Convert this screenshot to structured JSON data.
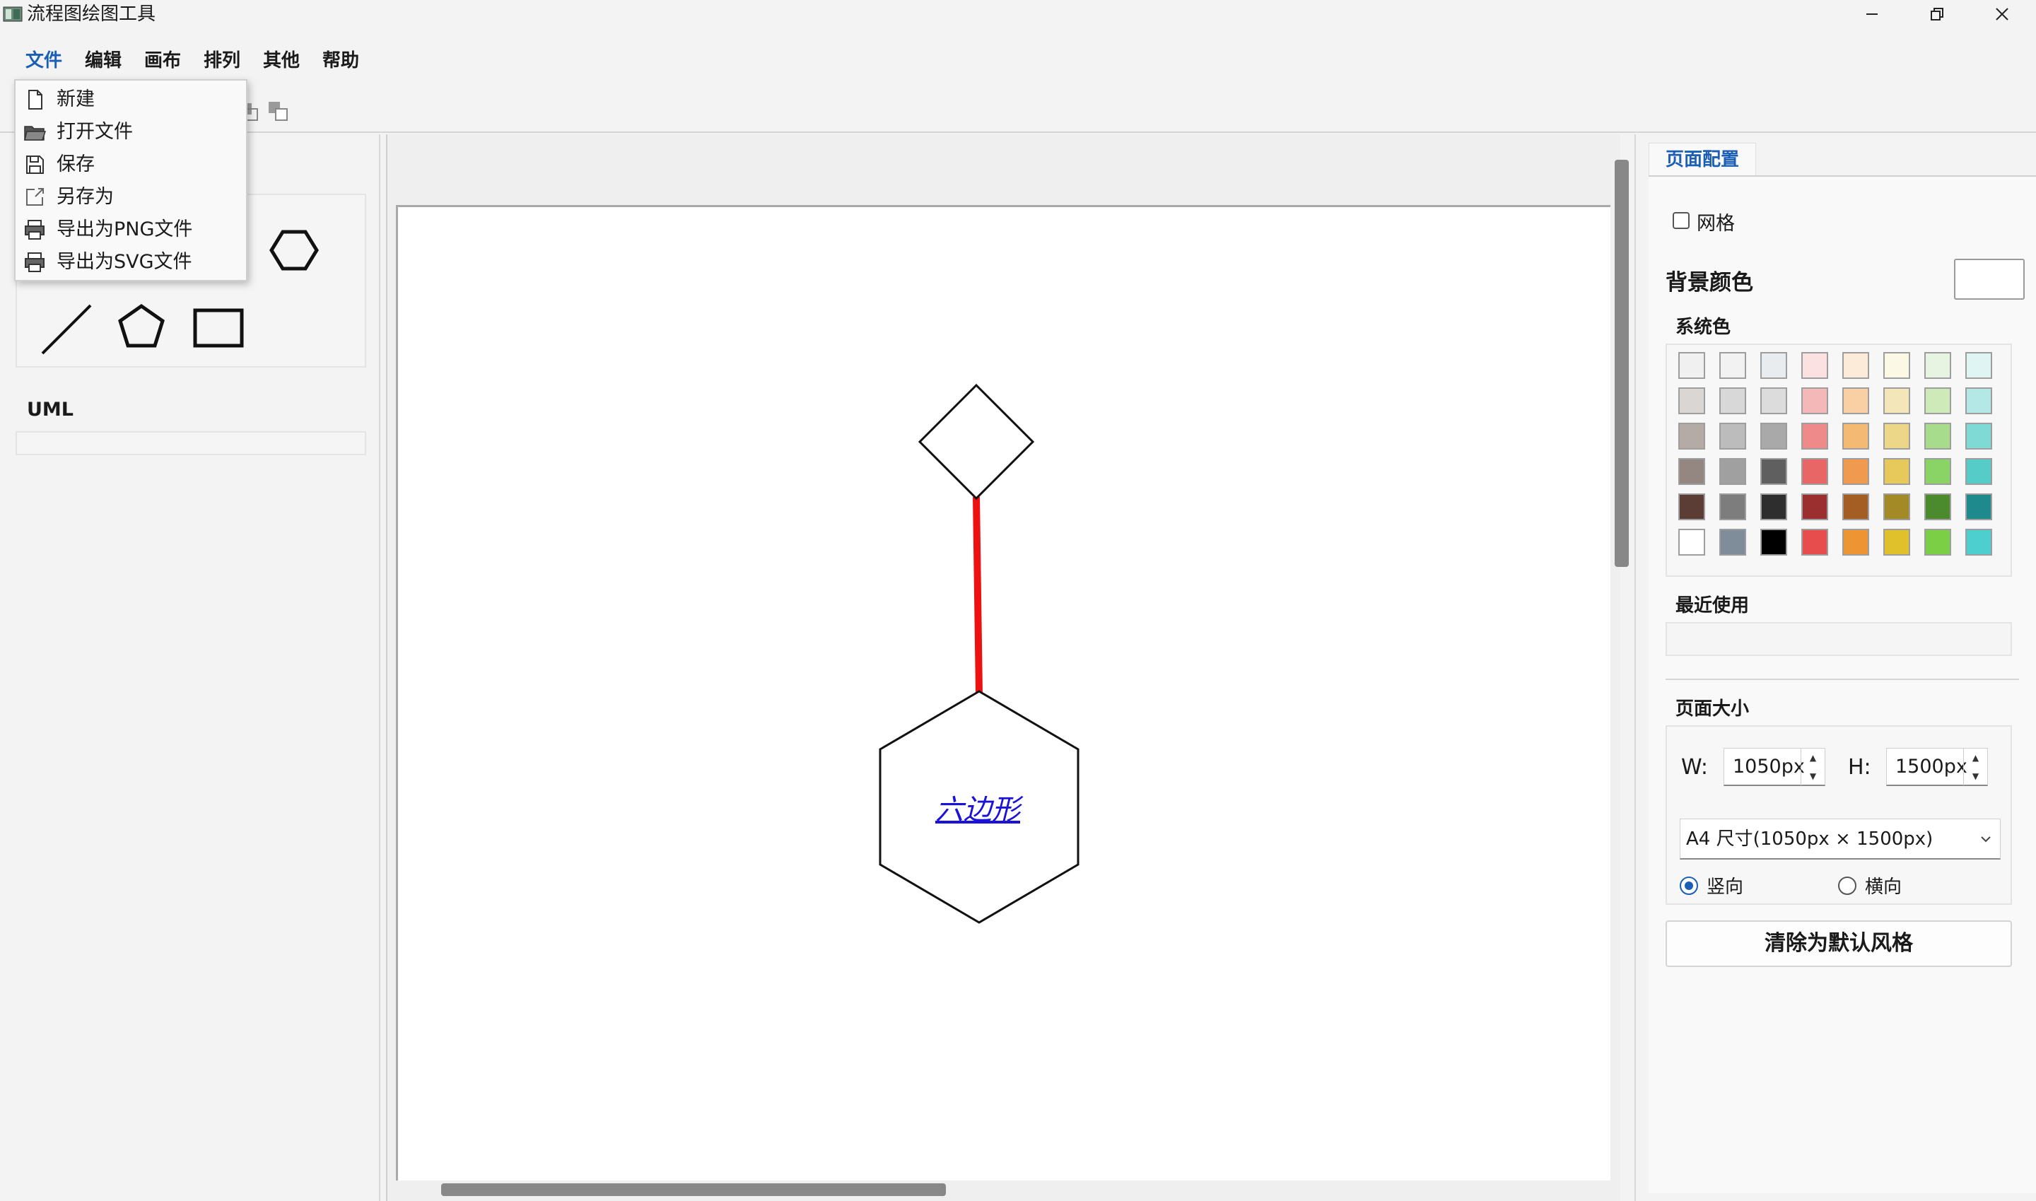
{
  "window": {
    "title": "流程图绘图工具"
  },
  "menubar": {
    "items": [
      "文件",
      "编辑",
      "画布",
      "排列",
      "其他",
      "帮助"
    ],
    "active": "文件"
  },
  "file_menu": {
    "items": [
      "新建",
      "打开文件",
      "保存",
      "另存为",
      "导出为PNG文件",
      "导出为SVG文件"
    ]
  },
  "left_panel": {
    "uml_title": "UML"
  },
  "canvas": {
    "hexagon_text": "六边形",
    "connector_color": "#ee1111"
  },
  "right_panel": {
    "tab": "页面配置",
    "grid_label": "网格",
    "bg_color_label": "背景颜色",
    "bg_color": "#ffffff",
    "system_colors_label": "系统色",
    "recent_label": "最近使用",
    "page_size_label": "页面大小",
    "w_label": "W:",
    "w_value": "1050px",
    "h_label": "H:",
    "h_value": "1500px",
    "size_preset": "A4 尺寸(1050px × 1500px)",
    "orientation_portrait": "竖向",
    "orientation_landscape": "横向",
    "reset_button": "清除为默认风格",
    "palette_rows": [
      [
        "#f0f0f0",
        "#f2f2f2",
        "#e9ecef",
        "#fbe1e1",
        "#fdebd9",
        "#fcf8e6",
        "#e6f4e1",
        "#dff5f4"
      ],
      [
        "#d9d6d4",
        "#d8d8d8",
        "#dcdcdc",
        "#f5b8b8",
        "#f9cfa4",
        "#f3e6b8",
        "#cdeab8",
        "#b3e8e6"
      ],
      [
        "#b5aba6",
        "#bcbcbc",
        "#a9a9a9",
        "#ef8a8a",
        "#f4b973",
        "#ecd788",
        "#a7dc8c",
        "#7fd9d5"
      ],
      [
        "#948680",
        "#a0a0a0",
        "#5f5f5f",
        "#e86666",
        "#f09a50",
        "#e6c95a",
        "#8ad466",
        "#55ccc7"
      ],
      [
        "#5b3d35",
        "#7d7d7d",
        "#2e2e2e",
        "#9b2f2f",
        "#a45e23",
        "#a38a27",
        "#4b8b2e",
        "#1f8a8e"
      ],
      [
        "#ffffff",
        "#7f8c99",
        "#000000",
        "#e84d4d",
        "#ee9533",
        "#e0c12c",
        "#7bcf45",
        "#4ecfcf"
      ]
    ]
  }
}
